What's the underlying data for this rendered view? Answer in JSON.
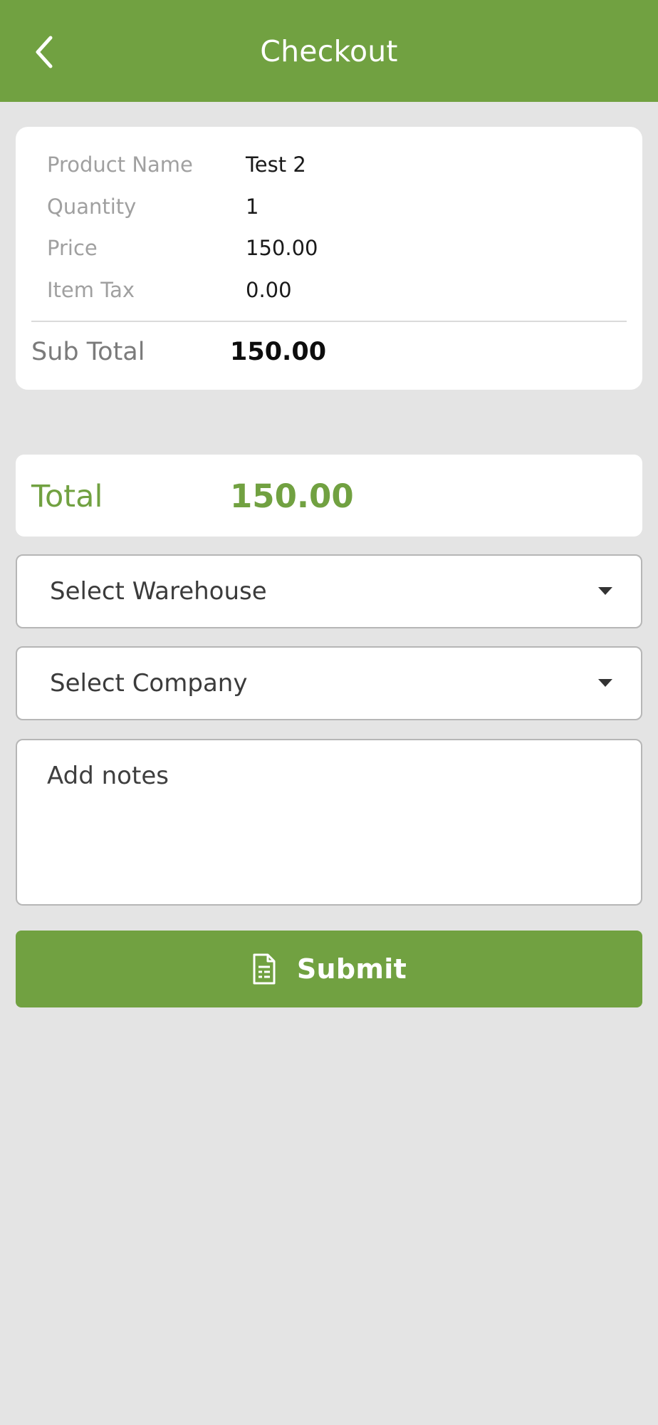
{
  "header": {
    "title": "Checkout",
    "back_icon": "chevron-left-icon"
  },
  "summary": {
    "rows": [
      {
        "label": "Product Name",
        "value": "Test 2"
      },
      {
        "label": "Quantity",
        "value": "1"
      },
      {
        "label": "Price",
        "value": "150.00"
      },
      {
        "label": "Item Tax",
        "value": "0.00"
      }
    ],
    "subtotal_label": "Sub Total",
    "subtotal_value": "150.00"
  },
  "total": {
    "label": "Total",
    "value": "150.00"
  },
  "warehouse_select": {
    "value": "Select Warehouse"
  },
  "company_select": {
    "value": "Select Company"
  },
  "notes": {
    "placeholder": "Add notes",
    "value": ""
  },
  "submit": {
    "label": "Submit",
    "icon": "document-icon"
  },
  "colors": {
    "brand_green": "#71a141",
    "background": "#e4e4e4"
  }
}
